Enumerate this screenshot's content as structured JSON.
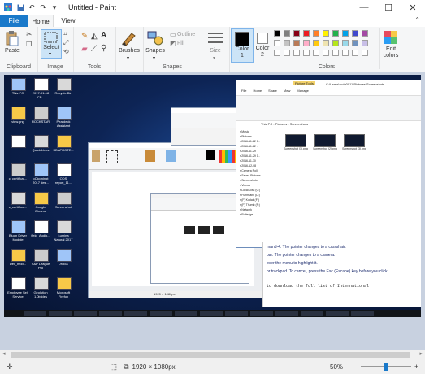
{
  "window": {
    "title": "Untitled - Paint",
    "minimize_glyph": "—",
    "maximize_glyph": "☐",
    "close_glyph": "✕"
  },
  "tabs": {
    "file": "File",
    "home": "Home",
    "view": "View"
  },
  "ribbon": {
    "clipboard": {
      "label": "Clipboard",
      "paste": "Paste"
    },
    "image": {
      "label": "Image",
      "select": "Select"
    },
    "tools": {
      "label": "Tools"
    },
    "brushes": {
      "label": "Brushes"
    },
    "shapes": {
      "label": "Shapes",
      "outline": "Outline",
      "fill": "Fill"
    },
    "size": {
      "label": "Size"
    },
    "color1": {
      "label": "Color\n1"
    },
    "color2": {
      "label": "Color\n2"
    },
    "colors": {
      "label": "Colors"
    },
    "edit_colors": {
      "label": "Edit\ncolors"
    },
    "palette_row1": [
      "#000000",
      "#7f7f7f",
      "#880015",
      "#ed1c24",
      "#ff7f27",
      "#fff200",
      "#22b14c",
      "#00a2e8",
      "#3f48cc",
      "#a349a4"
    ],
    "palette_row2": [
      "#ffffff",
      "#c3c3c3",
      "#b97a57",
      "#ffaec9",
      "#ffc90e",
      "#efe4b0",
      "#b5e61d",
      "#99d9ea",
      "#7092be",
      "#c8bfe7"
    ],
    "palette_row3": [
      "#ffffff",
      "#ffffff",
      "#ffffff",
      "#ffffff",
      "#ffffff",
      "#ffffff",
      "#ffffff",
      "#ffffff",
      "#ffffff",
      "#ffffff"
    ],
    "color1_value": "#000000",
    "color2_value": "#ffffff"
  },
  "canvas_content": {
    "desktop_icons": [
      "This PC",
      "2017-01-18 CP...",
      "Recycle Bin",
      "view.png",
      "ROCKSTAR",
      "Peardeck Assistant",
      "",
      "Quick Links",
      "SDAPROTE...",
      "c_certificat...",
      "oCiconingt 2017 des...",
      "QDS report_11...",
      "c_certificat...",
      "Google Chrome",
      "Screenshot",
      "Bluon Driver Module",
      "field_Audio...",
      "Lumina Natural 2017",
      "Dell_mod...",
      "S&P League Pro",
      "DroidX",
      "Employee Self Service",
      "Geolution 1.0bildes",
      "Microsoft Firefox"
    ],
    "explorer": {
      "title_badge": "Picture Tools",
      "path": "C:\\Users\\rudo0011\\Pictures\\Screenshots",
      "breadcrumb": "This PC › Pictures › Screenshots",
      "tabs": [
        "File",
        "Home",
        "Share",
        "View",
        "Manage"
      ],
      "folders": [
        "Music",
        "Pictures",
        "2016-11-22 1..",
        "2016-11-22 ..",
        "2016-11-29",
        "2016-11-29 1..",
        "2016-11-30",
        "2016-12-08",
        "Camera Roll",
        "Saved Pictures",
        "Screenshots",
        "Videos",
        "Local Disk (C:)",
        "Fuhrmann (D:)",
        "(F) Kodak (F:)",
        "(F) Thumb (F:)",
        "Network",
        "Rutledge"
      ],
      "files": [
        "Screenshot (1).png",
        "Screenshot (2).png",
        "Screenshot (3).png"
      ]
    },
    "document_lines": [
      "mand-4. The pointer changes to a crosshair.",
      "bar. The pointer changes to a camera.",
      "over the menu to highlight it.",
      "or trackpad. To cancel, press the Esc (Escape) key before you click.",
      "to download the full list of International"
    ],
    "inner_paint_size": "1920 × 1080px"
  },
  "statusbar": {
    "dimensions": "1920 × 1080px",
    "zoom": "50%",
    "zoom_fraction": 0.5,
    "minus": "—",
    "plus": "+"
  }
}
